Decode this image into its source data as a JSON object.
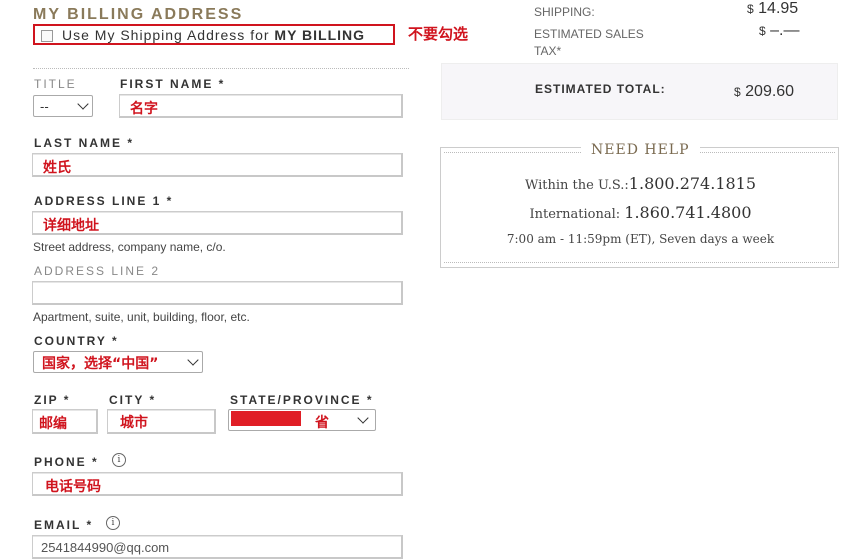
{
  "billing": {
    "title": "MY BILLING ADDRESS",
    "use_shipping_text": "Use My Shipping Address for",
    "use_shipping_bold": "MY BILLING",
    "annotation_no_check": "不要勾选"
  },
  "fields": {
    "title_label": "TITLE",
    "title_value": "--",
    "first_name_label": "FIRST NAME *",
    "first_name_value": "名字",
    "last_name_label": "LAST NAME *",
    "last_name_value": "姓氏",
    "address1_label": "ADDRESS LINE 1 *",
    "address1_value": "详细地址",
    "address1_hint": "Street address, company name, c/o.",
    "address2_label": "ADDRESS LINE 2",
    "address2_hint": "Apartment, suite, unit, building, floor, etc.",
    "country_label": "COUNTRY *",
    "country_value": "国家，选择“中国”",
    "zip_label": "ZIP *",
    "zip_value": "邮编",
    "city_label": "CITY *",
    "city_value": "城市",
    "state_label": "STATE/PROVINCE *",
    "state_value": "省",
    "phone_label": "PHONE *",
    "phone_value": "电话号码",
    "email_label": "EMAIL *",
    "email_value": "2541844990@qq.com"
  },
  "summary": {
    "shipping_label": "SHIPPING:",
    "shipping_currency": "$",
    "shipping_value": "14.95",
    "tax_label_line1": "ESTIMATED SALES",
    "tax_label_line2": "TAX*",
    "tax_currency": "$",
    "tax_value": "–.—",
    "total_label": "ESTIMATED TOTAL:",
    "total_currency": "$",
    "total_value": "209.60"
  },
  "help": {
    "title": "NEED HELP",
    "us_label": "Within the U.S.:",
    "us_number": "1.800.274.1815",
    "intl_label": "International:",
    "intl_number": "1.860.741.4800",
    "hours": "7:00 am - 11:59pm (ET), Seven days a week"
  },
  "icons": {
    "info": "info-icon",
    "chevron": "chevron-down-icon"
  },
  "colors": {
    "annotation_red": "#d0141e",
    "heading_brown": "#8a7a5a"
  }
}
